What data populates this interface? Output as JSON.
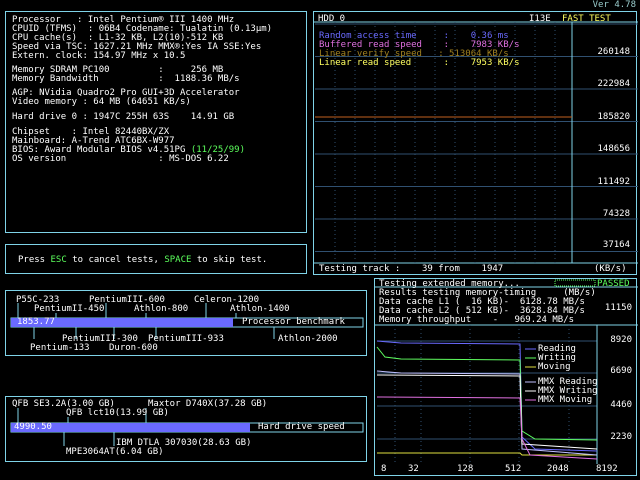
{
  "header": {
    "version": "Ver 4.78"
  },
  "system": {
    "processor": "Processor   : Intel Pentium® III 1400 MHz",
    "cpuid": "CPUID (TFMS)  : 06B4 Codename: Tualatin (0.13µm)",
    "cache": "CPU cache(s)  : L1-32 KB, L2(10)-512 KB",
    "speed": "Speed via TSC: 1627.21 MHz MMX®:Yes IA SSE:Yes",
    "extern": "Extern. clock: 154.97 MHz x 10.5",
    "memory": "Memory SDRAM PC100         :     256 MB",
    "bandwidth": "Memory Bandwidth           :  1188.36 MB/s",
    "agp": "AGP: NVidia Quadro2 Pro GUI+3D Accelerator",
    "video": "Video memory : 64 MB (64651 KB/s)",
    "hdd": "Hard drive 0 : 1947C 255H 63S    14.91 GB",
    "chipset": "Chipset    : Intel 82440BX/ZX",
    "mainboard": "Mainboard: A-Trend ATC6BX-W977",
    "bios": "BIOS: Award Modular BIOS v4.51PG ",
    "bios_date": "(11/25/99)",
    "os": "OS version                 : MS-DOS 6.22"
  },
  "hint": {
    "pre": "Press ",
    "esc": "ESC",
    "mid": " to cancel tests, ",
    "space": "SPACE",
    "post": " to skip test."
  },
  "hdd_test": {
    "title": "HDD 0",
    "right_title": "I13E",
    "mode": "FAST TEST",
    "legend": [
      {
        "label": "Random access time     :    0.36 ms",
        "color": "#6a6aff"
      },
      {
        "label": "Buffered read speed    :    7983 KB/s",
        "color": "#e070e0"
      },
      {
        "label": "Linear verify speed   : 513064 KB/s",
        "color": "#a08020"
      },
      {
        "label": "Linear read speed      :    7953 KB/s",
        "color": "#ffff60"
      }
    ],
    "yticks": [
      "260148",
      "222984",
      "185820",
      "148656",
      "111492",
      "74328",
      "37164"
    ],
    "footer": "Testing track :    39 from    1947",
    "unit": "(KB/s)",
    "trace_value": 185820
  },
  "memtest": {
    "title": "Testing extended memory...",
    "status": "PASSED",
    "line1": "Results testing memory-timing     (MB/s)",
    "line2": "Data cache L1 (  16 KB)-  6128.78 MB/s",
    "line3": "Data cache L2 ( 512 KB)-  3628.84 MB/s",
    "line4": "Memory throughput    -   969.24 MB/s",
    "scale_top": "11150",
    "yticks": [
      "8920",
      "6690",
      "4460",
      "2230"
    ],
    "xticks": [
      "8",
      "32",
      "128",
      "512",
      "2048",
      "8192"
    ],
    "legend": [
      {
        "label": "Reading",
        "color": "#6a6aff"
      },
      {
        "label": "Writing",
        "color": "#60ff60"
      },
      {
        "label": "Moving",
        "color": "#e0e040"
      },
      {
        "label": "MMX Reading",
        "color": "#c0c0ff"
      },
      {
        "label": "MMX Writing",
        "color": "#ffffff"
      },
      {
        "label": "MMX Moving",
        "color": "#e070e0"
      }
    ]
  },
  "cpu_bench": {
    "value": "1853.77",
    "label": "Processor benchmark",
    "fill_fraction": 0.63,
    "tags_top": [
      "P55C-233",
      "PentiumIII-600",
      "Celeron-1200",
      "PentiumII-450",
      "Athlon-800",
      "Athlon-1400"
    ],
    "tags_bottom": [
      "PentiumIII-300",
      "PentiumIII-933",
      "Athlon-2000",
      "Pentium-133",
      "Duron-600"
    ]
  },
  "disk_bench": {
    "value": "4990.50",
    "label": "Hard drive speed",
    "fill_fraction": 0.68,
    "tags_top": [
      "QFB SE3.2A(3.00 GB)",
      "Maxtor D740X(37.28 GB)",
      "QFB lct10(13.99 GB)"
    ],
    "tags_bottom": [
      "IBM DTLA 307030(28.63 GB)",
      "MPE3064AT(6.04 GB)"
    ]
  },
  "colors": {
    "border": "#7fd3e8",
    "bar": "#6a6aff",
    "accent_green": "#5cff5c",
    "accent_yellow": "#ffff60"
  }
}
